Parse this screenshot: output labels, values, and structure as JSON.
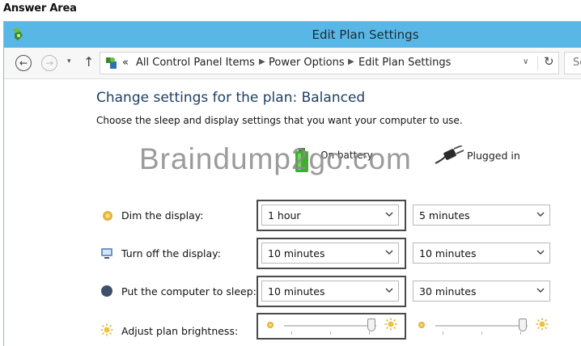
{
  "answer_area_label": "Answer Area",
  "window": {
    "title": "Edit Plan Settings"
  },
  "navbar": {
    "breadcrumb_prefix": "«",
    "breadcrumbs": [
      "All Control Panel Items",
      "Power Options",
      "Edit Plan Settings"
    ],
    "search_placeholder": "Se"
  },
  "content": {
    "heading": "Change settings for the plan: Balanced",
    "subheading": "Choose the sleep and display settings that you want your computer to use.",
    "watermark": "Braindump2go.com",
    "column_on_battery": "On battery",
    "column_plugged_in": "Plugged in"
  },
  "settings": [
    {
      "label": "Dim the display:",
      "icon": "dim-display-icon",
      "on_battery": "1 hour",
      "plugged_in": "5 minutes"
    },
    {
      "label": "Turn off the display:",
      "icon": "display-off-icon",
      "on_battery": "10 minutes",
      "plugged_in": "10 minutes"
    },
    {
      "label": "Put the computer to sleep:",
      "icon": "sleep-icon",
      "on_battery": "10 minutes",
      "plugged_in": "30 minutes"
    }
  ],
  "brightness": {
    "label": "Adjust plan brightness:",
    "on_battery_level": 0.95,
    "plugged_in_level": 0.95
  },
  "colors": {
    "titlebar": "#58b7e6",
    "heading": "#1e3e66"
  }
}
